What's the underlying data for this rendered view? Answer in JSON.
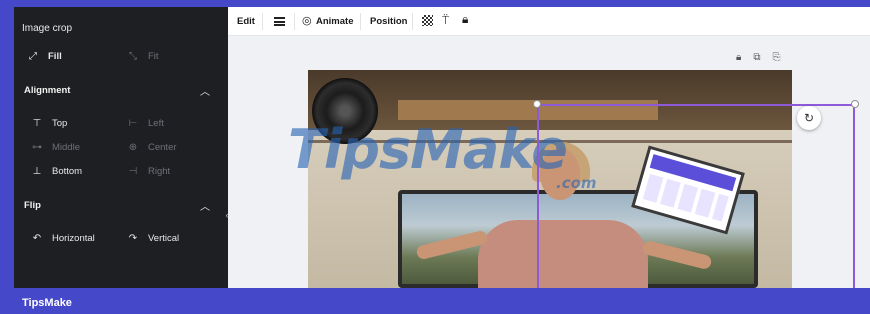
{
  "panel": {
    "title": "Image crop",
    "fill_label": "Fill",
    "fit_label": "Fit",
    "alignment": {
      "title": "Alignment",
      "items": [
        {
          "label": "Top",
          "icon": "align-top-icon"
        },
        {
          "label": "Left",
          "icon": "align-left-icon"
        },
        {
          "label": "Middle",
          "icon": "align-middle-icon"
        },
        {
          "label": "Center",
          "icon": "align-center-icon"
        },
        {
          "label": "Bottom",
          "icon": "align-bottom-icon"
        },
        {
          "label": "Right",
          "icon": "align-right-icon"
        }
      ]
    },
    "flip": {
      "title": "Flip",
      "horizontal_label": "Horizontal",
      "vertical_label": "Vertical"
    }
  },
  "toolbar": {
    "edit_label": "Edit",
    "animate_label": "Animate",
    "position_label": "Position"
  },
  "watermark": {
    "text": "TipsMake",
    "suffix": ".com"
  },
  "footer": {
    "brand": "TipsMake"
  },
  "colors": {
    "frame": "#4548c9",
    "panel": "#1e1f22",
    "selection": "#8f5ad9"
  }
}
